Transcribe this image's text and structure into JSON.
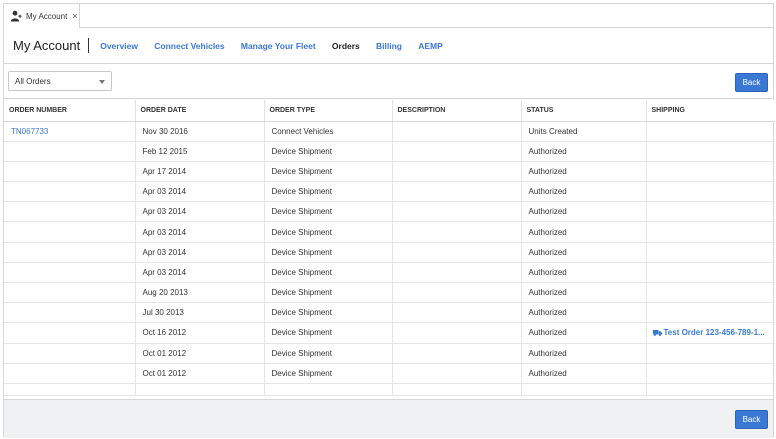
{
  "tab": {
    "label": "My Account",
    "close": "×",
    "icon": "user-icon"
  },
  "header": {
    "title": "My Account"
  },
  "nav": [
    {
      "label": "Overview",
      "active": false
    },
    {
      "label": "Connect Vehicles",
      "active": false
    },
    {
      "label": "Manage Your Fleet",
      "active": false
    },
    {
      "label": "Orders",
      "active": true
    },
    {
      "label": "Billing",
      "active": false
    },
    {
      "label": "AEMP",
      "active": false
    }
  ],
  "filter": {
    "value": "All Orders"
  },
  "buttons": {
    "back_top": "Back",
    "back_bottom": "Back"
  },
  "colors": {
    "accent": "#3a78d6"
  },
  "table": {
    "columns": [
      "ORDER NUMBER",
      "ORDER DATE",
      "ORDER TYPE",
      "DESCRIPTION",
      "STATUS",
      "SHIPPING"
    ],
    "rows": [
      {
        "number": "TN067733",
        "date": "Nov 30 2016",
        "type": "Connect Vehicles",
        "description": "",
        "status": "Units Created",
        "shipping": ""
      },
      {
        "number": "",
        "date": "Feb 12 2015",
        "type": "Device Shipment",
        "description": "",
        "status": "Authorized",
        "shipping": ""
      },
      {
        "number": "",
        "date": "Apr 17 2014",
        "type": "Device Shipment",
        "description": "",
        "status": "Authorized",
        "shipping": ""
      },
      {
        "number": "",
        "date": "Apr 03 2014",
        "type": "Device Shipment",
        "description": "",
        "status": "Authorized",
        "shipping": ""
      },
      {
        "number": "",
        "date": "Apr 03 2014",
        "type": "Device Shipment",
        "description": "",
        "status": "Authorized",
        "shipping": ""
      },
      {
        "number": "",
        "date": "Apr 03 2014",
        "type": "Device Shipment",
        "description": "",
        "status": "Authorized",
        "shipping": ""
      },
      {
        "number": "",
        "date": "Apr 03 2014",
        "type": "Device Shipment",
        "description": "",
        "status": "Authorized",
        "shipping": ""
      },
      {
        "number": "",
        "date": "Apr 03 2014",
        "type": "Device Shipment",
        "description": "",
        "status": "Authorized",
        "shipping": ""
      },
      {
        "number": "",
        "date": "Aug 20 2013",
        "type": "Device Shipment",
        "description": "",
        "status": "Authorized",
        "shipping": ""
      },
      {
        "number": "",
        "date": "Jul 30 2013",
        "type": "Device Shipment",
        "description": "",
        "status": "Authorized",
        "shipping": ""
      },
      {
        "number": "",
        "date": "Oct 16 2012",
        "type": "Device Shipment",
        "description": "",
        "status": "Authorized",
        "shipping": "Test Order 123-456-789-1..."
      },
      {
        "number": "",
        "date": "Oct 01 2012",
        "type": "Device Shipment",
        "description": "",
        "status": "Authorized",
        "shipping": ""
      },
      {
        "number": "",
        "date": "Oct 01 2012",
        "type": "Device Shipment",
        "description": "",
        "status": "Authorized",
        "shipping": ""
      }
    ]
  }
}
